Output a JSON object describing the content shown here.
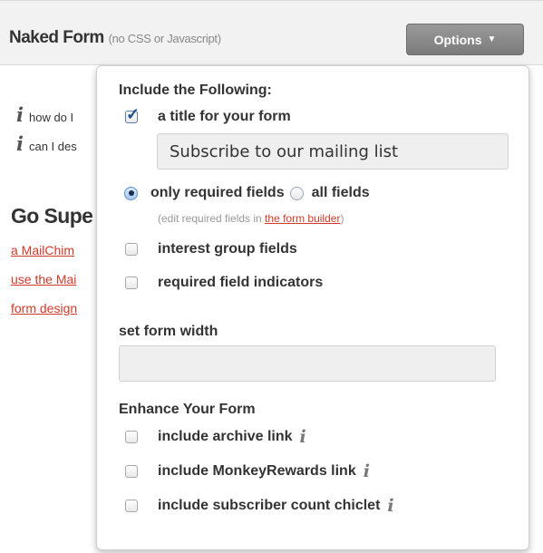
{
  "header": {
    "title": "Naked Form",
    "subtitle": "(no CSS or Javascript)",
    "options_button": "Options",
    "options_caret": "▼"
  },
  "background": {
    "help_items": [
      "how do I",
      "can I des"
    ],
    "heading": "Go Supe",
    "links": [
      "a MailChim",
      "use the Mai",
      "form design"
    ]
  },
  "dropdown": {
    "include_heading": "Include the Following:",
    "title_option": {
      "label": "a title for your form",
      "checked": true
    },
    "title_value": "Subscribe to our mailing list",
    "fields_option": {
      "required_label": "only required fields",
      "all_label": "all fields",
      "selected": "required"
    },
    "note_prefix": "(edit required fields in ",
    "note_link": "the form builder",
    "note_suffix": ")",
    "interest_group_label": "interest group fields",
    "required_indicators_label": "required field indicators",
    "width_heading": "set form width",
    "width_value": "",
    "enhance_heading": "Enhance Your Form",
    "archive_label": "include archive link",
    "monkeyrewards_label": "include MonkeyRewards link",
    "chiclet_label": "include subscriber count chiclet",
    "info_glyph": "i"
  }
}
